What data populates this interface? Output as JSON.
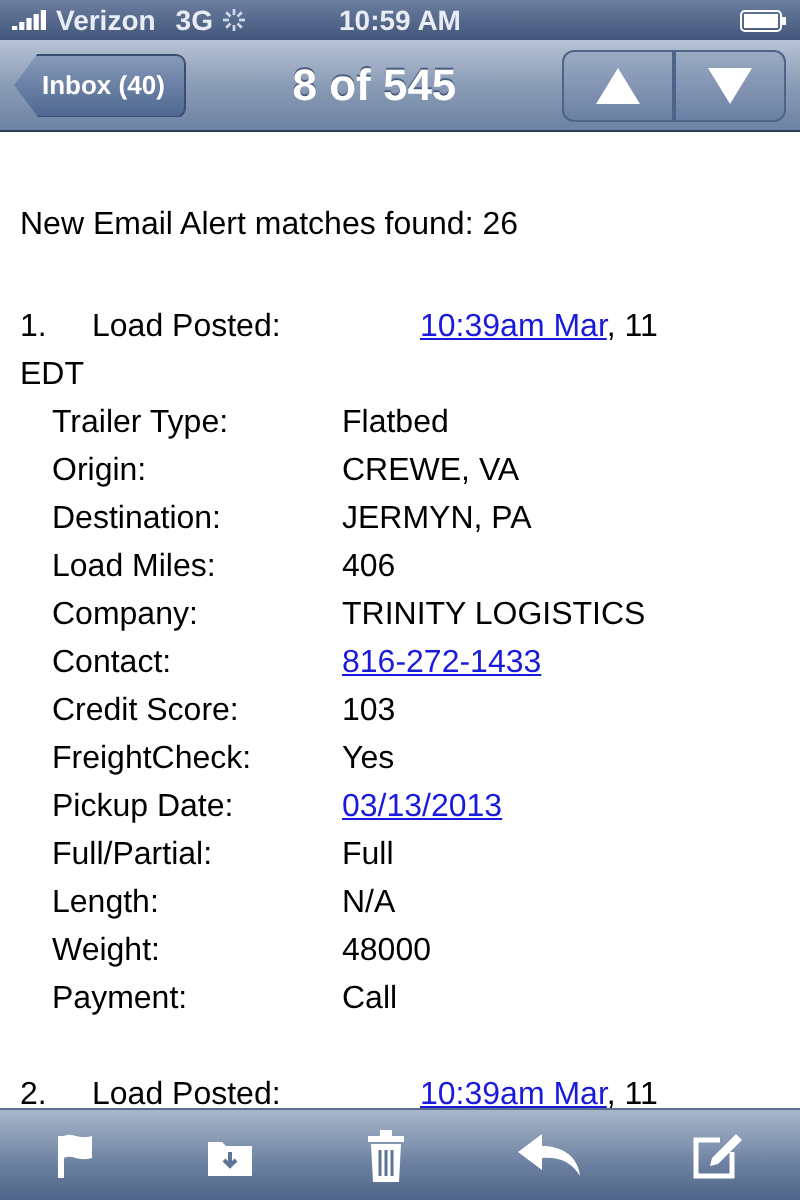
{
  "status_bar": {
    "carrier": "Verizon",
    "network": "3G",
    "time": "10:59 AM"
  },
  "nav": {
    "back": "Inbox (40)",
    "title": "8 of 545"
  },
  "intro": "New Email Alert matches found: 26",
  "loads": [
    {
      "number": "1.",
      "label": "Load Posted:",
      "posted_link": "10:39am Mar",
      "posted_rest": ", 11 EDT",
      "fields": [
        {
          "label": "Trailer Type:",
          "value": "Flatbed",
          "kind": "text"
        },
        {
          "label": "Origin:",
          "value": "CREWE, VA",
          "kind": "text"
        },
        {
          "label": "Destination:",
          "value": "JERMYN, PA",
          "kind": "text"
        },
        {
          "label": "Load Miles:",
          "value": "406",
          "kind": "text"
        },
        {
          "label": "Company:",
          "value": "TRINITY LOGISTICS",
          "kind": "text"
        },
        {
          "label": "Contact:",
          "value": "816-272-1433",
          "kind": "link"
        },
        {
          "label": "Credit Score:",
          "value": "103",
          "kind": "text"
        },
        {
          "label": "FreightCheck:",
          "value": "Yes",
          "kind": "text"
        },
        {
          "label": "Pickup Date:",
          "value": "03/13/2013",
          "kind": "link"
        },
        {
          "label": "Full/Partial:",
          "value": "Full",
          "kind": "text"
        },
        {
          "label": "Length:",
          "value": "N/A",
          "kind": "text"
        },
        {
          "label": "Weight:",
          "value": "48000",
          "kind": "text"
        },
        {
          "label": "Payment:",
          "value": "Call",
          "kind": "text"
        }
      ]
    },
    {
      "number": "2.",
      "label": "Load Posted:",
      "posted_link": "10:39am Mar",
      "posted_rest": ", 11"
    }
  ]
}
